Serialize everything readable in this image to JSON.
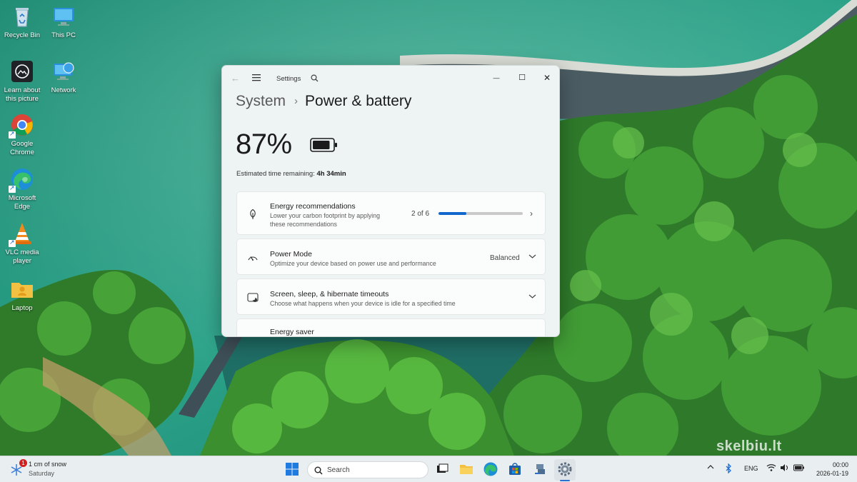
{
  "desktop": {
    "icons": [
      {
        "label": "Recycle Bin",
        "icon": "recycle-bin-icon"
      },
      {
        "label": "This PC",
        "icon": "monitor-icon"
      },
      {
        "label": "Learn about this picture",
        "icon": "camera-icon"
      },
      {
        "label": "Network",
        "icon": "network-icon"
      },
      {
        "label": "Google Chrome",
        "icon": "chrome-icon"
      },
      {
        "label": "Microsoft Edge",
        "icon": "edge-icon"
      },
      {
        "label": "VLC media player",
        "icon": "vlc-icon"
      },
      {
        "label": "Laptop",
        "icon": "user-folder-icon"
      }
    ]
  },
  "window": {
    "app_title": "Settings",
    "breadcrumb": {
      "parent": "System",
      "separator": "›",
      "current": "Power & battery"
    },
    "battery": {
      "percent_text": "87%",
      "level": 87
    },
    "estimate": {
      "label": "Estimated time remaining:",
      "value": "4h 34min"
    },
    "cards": {
      "energy": {
        "title": "Energy recommendations",
        "desc_line1": "Lower your carbon footprint by applying",
        "desc_line2": "these recommendations",
        "count": "2 of 6",
        "progress_fraction": 0.333
      },
      "power_mode": {
        "title": "Power Mode",
        "desc": "Optimize your device based on power use and performance",
        "value": "Balanced"
      },
      "timeouts": {
        "title": "Screen, sleep, & hibernate timeouts",
        "desc": "Choose what happens when your device is idle for a specified time"
      },
      "saver": {
        "title": "Energy saver"
      }
    },
    "controls": {
      "minimize": "—",
      "maximize": "☐",
      "close": "✕"
    }
  },
  "taskbar": {
    "weather": {
      "badge": "1",
      "temp": "1 cm of snow",
      "day": "Saturday"
    },
    "search_placeholder": "Search",
    "tray": {
      "language": "ENG"
    },
    "clock": {
      "time": "00:00",
      "date": "2026-01-19"
    }
  },
  "watermark": "skelbiu.lt",
  "colors": {
    "accent": "#1267cc",
    "window_bg": "#eef4f3",
    "taskbar_bg": "#e9eef0"
  }
}
